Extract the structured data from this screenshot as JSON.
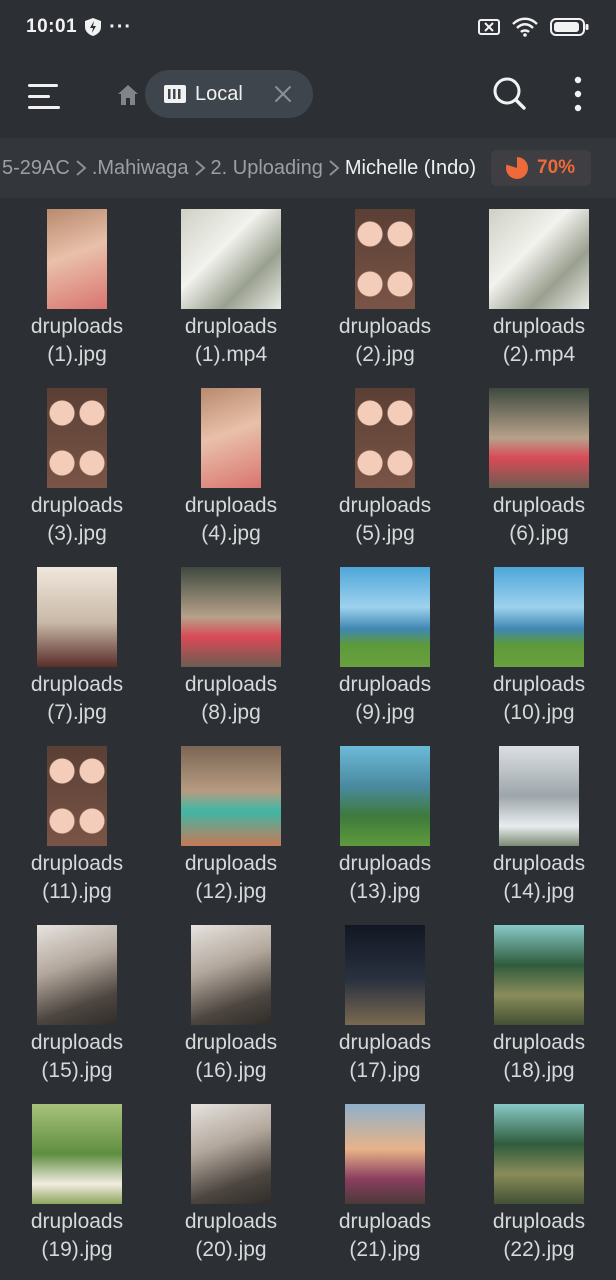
{
  "status_bar": {
    "time": "10:01",
    "dots": "···",
    "icons": [
      "shield-icon",
      "sim-off-icon",
      "wifi-icon",
      "battery-icon"
    ]
  },
  "toolbar": {
    "tab_label": "Local",
    "icons": [
      "menu-icon",
      "home-icon",
      "storage-icon",
      "close-icon",
      "search-icon",
      "more-vert-icon"
    ]
  },
  "breadcrumb": {
    "items": [
      "5-29AC",
      ".Mahiwaga",
      "2. Uploading",
      "Michelle (Indo)"
    ],
    "storage_used": "70%",
    "storage_color": "#ef6a3a"
  },
  "files": [
    {
      "line1": "druploads",
      "line2": "(1).jpg"
    },
    {
      "line1": "druploads",
      "line2": "(1).mp4"
    },
    {
      "line1": "druploads",
      "line2": "(2).jpg"
    },
    {
      "line1": "druploads",
      "line2": "(2).mp4"
    },
    {
      "line1": "druploads",
      "line2": "(3).jpg"
    },
    {
      "line1": "druploads",
      "line2": "(4).jpg"
    },
    {
      "line1": "druploads",
      "line2": "(5).jpg"
    },
    {
      "line1": "druploads",
      "line2": "(6).jpg"
    },
    {
      "line1": "druploads",
      "line2": "(7).jpg"
    },
    {
      "line1": "druploads",
      "line2": "(8).jpg"
    },
    {
      "line1": "druploads",
      "line2": "(9).jpg"
    },
    {
      "line1": "druploads",
      "line2": "(10).jpg"
    },
    {
      "line1": "druploads",
      "line2": "(11).jpg"
    },
    {
      "line1": "druploads",
      "line2": "(12).jpg"
    },
    {
      "line1": "druploads",
      "line2": "(13).jpg"
    },
    {
      "line1": "druploads",
      "line2": "(14).jpg"
    },
    {
      "line1": "druploads",
      "line2": "(15).jpg"
    },
    {
      "line1": "druploads",
      "line2": "(16).jpg"
    },
    {
      "line1": "druploads",
      "line2": "(17).jpg"
    },
    {
      "line1": "druploads",
      "line2": "(18).jpg"
    },
    {
      "line1": "druploads",
      "line2": "(19).jpg"
    },
    {
      "line1": "druploads",
      "line2": "(20).jpg"
    },
    {
      "line1": "druploads",
      "line2": "(21).jpg"
    },
    {
      "line1": "druploads",
      "line2": "(22).jpg"
    }
  ]
}
